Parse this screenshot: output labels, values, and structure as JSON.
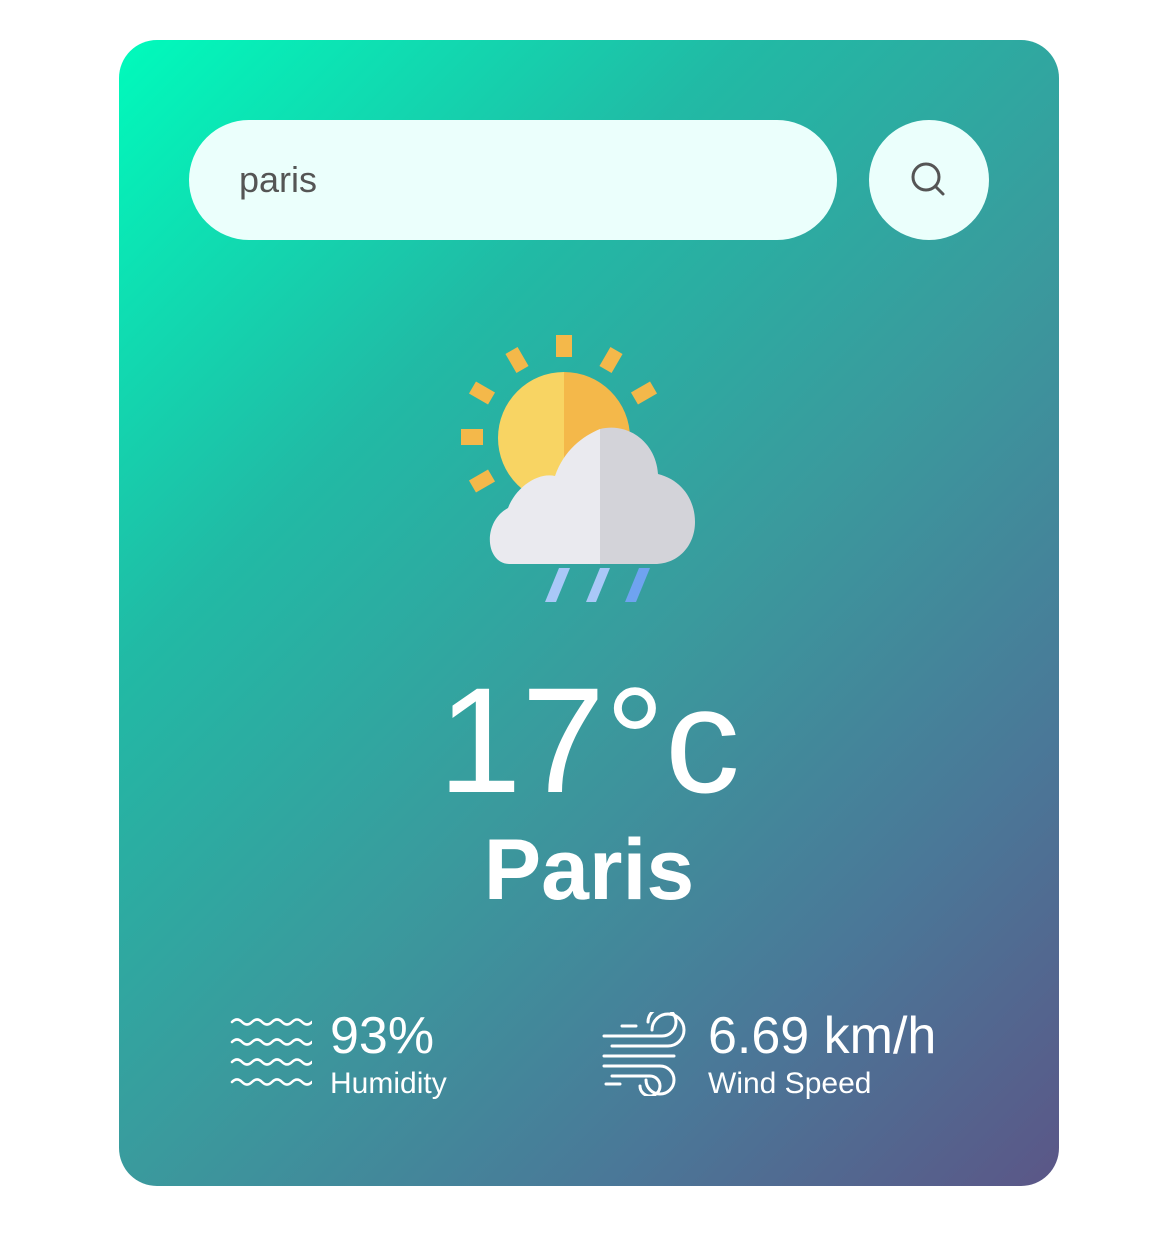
{
  "search": {
    "value": "paris",
    "icon": "search-icon"
  },
  "weather": {
    "icon": "sun-cloud-rain-icon",
    "temperature": "17°c",
    "city": "Paris"
  },
  "details": {
    "humidity": {
      "icon": "humidity-waves-icon",
      "value": "93%",
      "label": "Humidity"
    },
    "wind": {
      "icon": "wind-icon",
      "value": "6.69 km/h",
      "label": "Wind Speed"
    }
  },
  "colors": {
    "gradient_start": "#00fbbc",
    "gradient_end": "#5b5687",
    "search_bg": "#ebfffc",
    "text": "#ffffff"
  }
}
